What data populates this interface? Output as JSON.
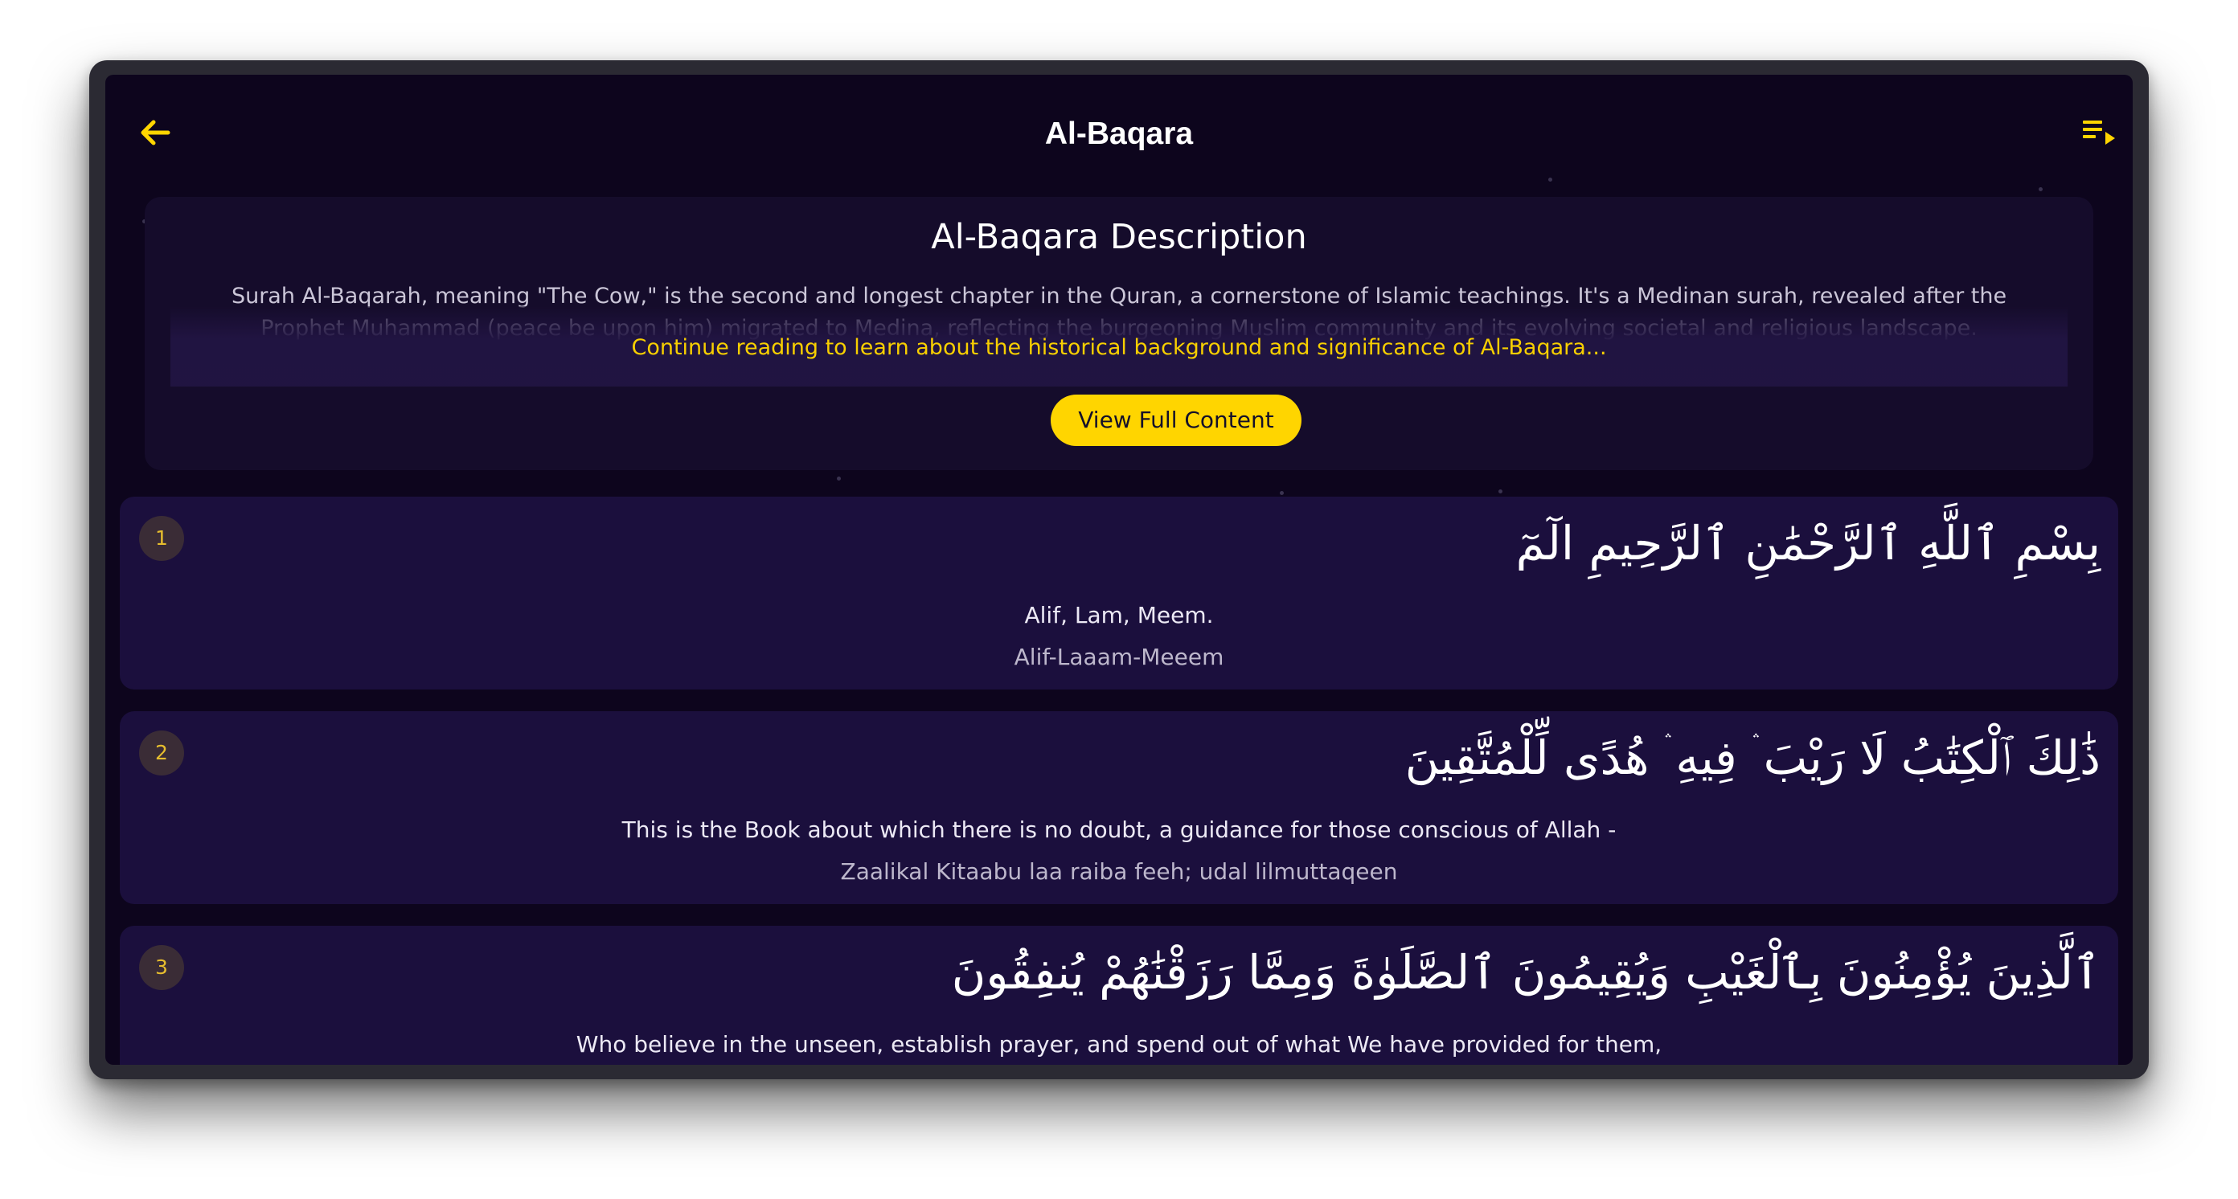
{
  "header": {
    "title": "Al-Baqara",
    "back_icon": "arrow-left-icon",
    "playlist_icon": "playlist-play-icon",
    "accent_color": "#FFD500"
  },
  "description": {
    "title": "Al-Baqara Description",
    "text": "Surah Al-Baqarah, meaning \"The Cow,\" is the second and longest chapter in the Quran, a cornerstone of Islamic teachings. It's a Medinan surah, revealed after the Prophet Muhammad (peace be upon him) migrated to Medina, reflecting the burgeoning Muslim community and its evolving societal and religious landscape.",
    "continue_text": "Continue reading to learn about the historical background and significance of Al-Baqara...",
    "button_label": "View Full Content"
  },
  "verses": [
    {
      "number": "1",
      "arabic": "بِسْمِ ٱللَّهِ ٱلرَّحْمَٰنِ ٱلرَّحِيمِ الٓمٓ",
      "translation": "Alif, Lam, Meem.",
      "transliteration": "Alif-Laaam-Meeem"
    },
    {
      "number": "2",
      "arabic": "ذَٰلِكَ ٱلْكِتَٰبُ لَا رَيْبَ ۛ فِيهِ ۛ هُدًى لِّلْمُتَّقِينَ",
      "translation": "This is the Book about which there is no doubt, a guidance for those conscious of Allah -",
      "transliteration": "Zaalikal Kitaabu laa raiba feeh; udal lilmuttaqeen"
    },
    {
      "number": "3",
      "arabic": "ٱلَّذِينَ يُؤْمِنُونَ بِٱلْغَيْبِ وَيُقِيمُونَ ٱلصَّلَوٰةَ وَمِمَّا رَزَقْنَٰهُمْ يُنفِقُونَ",
      "translation": "Who believe in the unseen, establish prayer, and spend out of what We have provided for them,",
      "transliteration": ""
    }
  ]
}
